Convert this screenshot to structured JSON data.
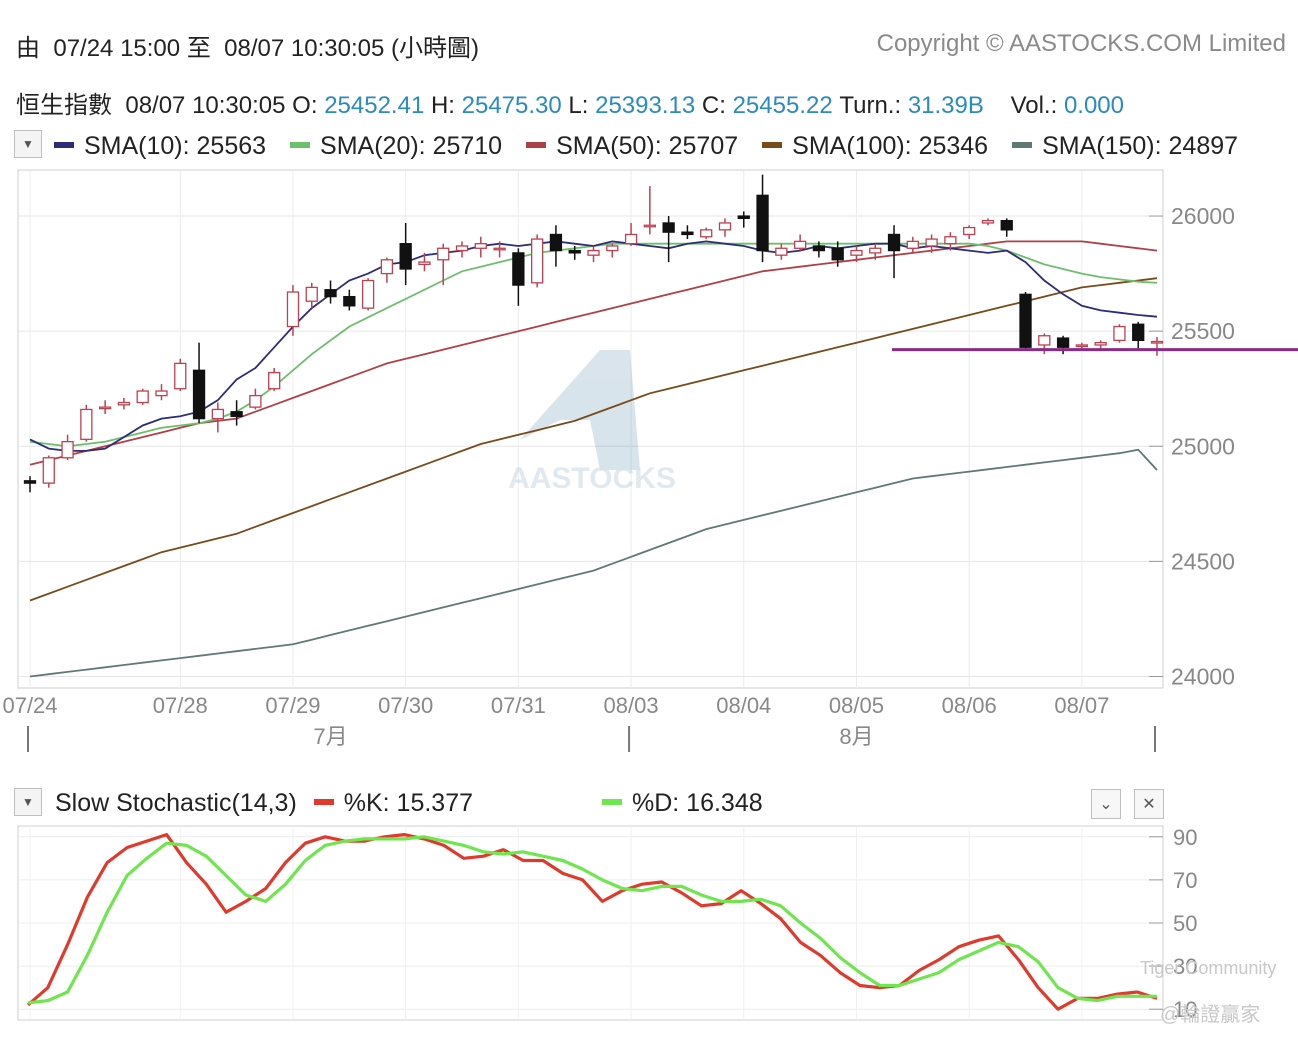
{
  "header": {
    "range_prefix": "由",
    "range_from": "07/24 15:00",
    "range_to_word": "至",
    "range_to": "08/07 10:30:05",
    "range_suffix": "(小時圖)",
    "copyright": "Copyright © AASTOCKS.COM Limited"
  },
  "quote": {
    "name": "恒生指數",
    "time": "08/07 10:30:05",
    "o_label": "O:",
    "o": "25452.41",
    "h_label": "H:",
    "h": "25475.30",
    "l_label": "L:",
    "l": "25393.13",
    "c_label": "C:",
    "c": "25455.22",
    "turn_label": "Turn.:",
    "turn": "31.39B",
    "vol_label": "Vol.:",
    "vol": "0.000"
  },
  "colors": {
    "up": "#c04050",
    "down": "#111111",
    "sma10": "#2c2c7a",
    "sma20": "#6cc06c",
    "sma50": "#b04048",
    "sma100": "#7a4a1a",
    "sma150": "#5f7a76",
    "k": "#e03a2c",
    "d": "#6ee64e",
    "hline": "#8a2b8a",
    "value_text": "#2a8bbd"
  },
  "icons": {
    "dropdown": "triangle-down-icon",
    "collapse": "chevron-down-icon",
    "close": "close-icon",
    "watermark": "aastocks-logo"
  },
  "watermark": {
    "text": "AASTOCKS",
    "community": "Tiger Community",
    "author": "@輪證贏家"
  },
  "chart_data": [
    {
      "type": "candlestick",
      "ylim": [
        23950,
        26200
      ],
      "yticks": [
        24000,
        24500,
        25000,
        25500,
        26000
      ],
      "grid": true,
      "legend": "top",
      "x_tick_labels": [
        "07/24",
        "07/28",
        "07/29",
        "07/30",
        "07/31",
        "08/03",
        "08/04",
        "08/05",
        "08/06",
        "08/07"
      ],
      "x_tick_index": [
        0,
        8,
        14,
        20,
        26,
        32,
        38,
        44,
        50,
        56
      ],
      "month_labels": [
        {
          "label": "7月",
          "index": 16
        },
        {
          "label": "8月",
          "index": 44
        }
      ],
      "sma_legend": [
        {
          "name": "SMA(10)",
          "value": "25563",
          "key": "sma10"
        },
        {
          "name": "SMA(20)",
          "value": "25710",
          "key": "sma20"
        },
        {
          "name": "SMA(50)",
          "value": "25707",
          "key": "sma50"
        },
        {
          "name": "SMA(100)",
          "value": "25346",
          "key": "sma100"
        },
        {
          "name": "SMA(150)",
          "value": "24897",
          "key": "sma150"
        }
      ],
      "horizontal_line": 25420,
      "candles": [
        [
          24850,
          24870,
          24800,
          24840
        ],
        [
          24840,
          24960,
          24820,
          24950
        ],
        [
          24950,
          25050,
          24940,
          25020
        ],
        [
          25030,
          25180,
          25020,
          25160
        ],
        [
          25170,
          25200,
          25140,
          25170
        ],
        [
          25180,
          25210,
          25160,
          25190
        ],
        [
          25190,
          25250,
          25180,
          25240
        ],
        [
          25220,
          25270,
          25200,
          25240
        ],
        [
          25250,
          25380,
          25240,
          25360
        ],
        [
          25330,
          25450,
          25100,
          25120
        ],
        [
          25120,
          25190,
          25060,
          25160
        ],
        [
          25150,
          25200,
          25090,
          25130
        ],
        [
          25170,
          25250,
          25160,
          25220
        ],
        [
          25250,
          25340,
          25240,
          25320
        ],
        [
          25520,
          25700,
          25480,
          25670
        ],
        [
          25630,
          25710,
          25600,
          25690
        ],
        [
          25680,
          25720,
          25620,
          25650
        ],
        [
          25650,
          25680,
          25590,
          25610
        ],
        [
          25600,
          25730,
          25590,
          25720
        ],
        [
          25750,
          25820,
          25710,
          25810
        ],
        [
          25880,
          25970,
          25700,
          25770
        ],
        [
          25790,
          25840,
          25760,
          25800
        ],
        [
          25810,
          25880,
          25700,
          25860
        ],
        [
          25850,
          25890,
          25820,
          25870
        ],
        [
          25860,
          25910,
          25820,
          25880
        ],
        [
          25860,
          25890,
          25820,
          25860
        ],
        [
          25840,
          25860,
          25610,
          25700
        ],
        [
          25710,
          25920,
          25690,
          25900
        ],
        [
          25920,
          25960,
          25780,
          25850
        ],
        [
          25850,
          25870,
          25810,
          25840
        ],
        [
          25830,
          25870,
          25800,
          25850
        ],
        [
          25850,
          25880,
          25820,
          25870
        ],
        [
          25880,
          25970,
          25870,
          25920
        ],
        [
          25960,
          26130,
          25920,
          25960
        ],
        [
          25970,
          26000,
          25800,
          25930
        ],
        [
          25930,
          25960,
          25900,
          25920
        ],
        [
          25910,
          25950,
          25900,
          25940
        ],
        [
          25940,
          25990,
          25910,
          25970
        ],
        [
          26000,
          26020,
          25950,
          25990
        ],
        [
          26090,
          26180,
          25800,
          25850
        ],
        [
          25830,
          25880,
          25810,
          25860
        ],
        [
          25860,
          25920,
          25850,
          25890
        ],
        [
          25870,
          25890,
          25820,
          25850
        ],
        [
          25860,
          25890,
          25780,
          25810
        ],
        [
          25830,
          25870,
          25800,
          25850
        ],
        [
          25840,
          25880,
          25810,
          25860
        ],
        [
          25920,
          25960,
          25730,
          25850
        ],
        [
          25860,
          25910,
          25840,
          25890
        ],
        [
          25870,
          25920,
          25840,
          25900
        ],
        [
          25880,
          25930,
          25850,
          25910
        ],
        [
          25920,
          25960,
          25900,
          25950
        ],
        [
          25970,
          25990,
          25960,
          25980
        ],
        [
          25980,
          25990,
          25910,
          25940
        ],
        [
          25660,
          25670,
          25420,
          25430
        ],
        [
          25440,
          25490,
          25400,
          25480
        ],
        [
          25470,
          25480,
          25400,
          25430
        ],
        [
          25440,
          25450,
          25420,
          25440
        ],
        [
          25440,
          25460,
          25420,
          25450
        ],
        [
          25460,
          25530,
          25450,
          25520
        ],
        [
          25530,
          25540,
          25420,
          25460
        ],
        [
          25450,
          25475,
          25393,
          25455
        ]
      ],
      "sma10": [
        25030,
        24990,
        24980,
        24980,
        24990,
        25040,
        25090,
        25120,
        25130,
        25150,
        25200,
        25290,
        25340,
        25430,
        25520,
        25600,
        25660,
        25720,
        25750,
        25790,
        25800,
        25830,
        25840,
        25850,
        25870,
        25880,
        25870,
        25880,
        25890,
        25880,
        25870,
        25890,
        25880,
        25870,
        25860,
        25880,
        25890,
        25880,
        25870,
        25850,
        25840,
        25850,
        25870,
        25860,
        25870,
        25880,
        25880,
        25860,
        25870,
        25860,
        25850,
        25840,
        25850,
        25800,
        25720,
        25660,
        25610,
        25590,
        25580,
        25570,
        25563
      ],
      "sma20": [
        25020,
        25010,
        25000,
        25010,
        25020,
        25040,
        25060,
        25080,
        25090,
        25100,
        25120,
        25150,
        25200,
        25260,
        25330,
        25400,
        25460,
        25520,
        25560,
        25600,
        25640,
        25680,
        25720,
        25760,
        25780,
        25800,
        25820,
        25840,
        25850,
        25860,
        25870,
        25880,
        25880,
        25880,
        25880,
        25880,
        25880,
        25880,
        25880,
        25880,
        25880,
        25880,
        25880,
        25880,
        25880,
        25880,
        25880,
        25880,
        25880,
        25880,
        25880,
        25870,
        25850,
        25820,
        25790,
        25770,
        25750,
        25735,
        25725,
        25715,
        25710
      ],
      "sma50": [
        24920,
        24940,
        24960,
        24980,
        25000,
        25020,
        25040,
        25060,
        25080,
        25100,
        25110,
        25120,
        25150,
        25180,
        25210,
        25240,
        25270,
        25300,
        25330,
        25360,
        25380,
        25400,
        25420,
        25440,
        25460,
        25480,
        25500,
        25520,
        25540,
        25560,
        25580,
        25600,
        25620,
        25640,
        25660,
        25680,
        25700,
        25720,
        25740,
        25760,
        25770,
        25780,
        25790,
        25800,
        25810,
        25820,
        25830,
        25840,
        25850,
        25860,
        25870,
        25880,
        25890,
        25890,
        25890,
        25890,
        25890,
        25880,
        25870,
        25860,
        25850
      ],
      "sma100": [
        24330,
        24360,
        24390,
        24420,
        24450,
        24480,
        24510,
        24540,
        24560,
        24580,
        24600,
        24620,
        24650,
        24680,
        24710,
        24740,
        24770,
        24800,
        24830,
        24860,
        24890,
        24920,
        24950,
        24980,
        25010,
        25030,
        25050,
        25070,
        25090,
        25110,
        25140,
        25170,
        25200,
        25230,
        25250,
        25270,
        25290,
        25310,
        25330,
        25350,
        25370,
        25390,
        25410,
        25430,
        25450,
        25470,
        25490,
        25510,
        25530,
        25550,
        25570,
        25590,
        25610,
        25630,
        25650,
        25670,
        25690,
        25700,
        25710,
        25720,
        25730
      ],
      "sma150": [
        24000,
        24010,
        24020,
        24030,
        24040,
        24050,
        24060,
        24070,
        24080,
        24090,
        24100,
        24110,
        24120,
        24130,
        24140,
        24160,
        24180,
        24200,
        24220,
        24240,
        24260,
        24280,
        24300,
        24320,
        24340,
        24360,
        24380,
        24400,
        24420,
        24440,
        24460,
        24490,
        24520,
        24550,
        24580,
        24610,
        24640,
        24660,
        24680,
        24700,
        24720,
        24740,
        24760,
        24780,
        24800,
        24820,
        24840,
        24860,
        24870,
        24880,
        24890,
        24900,
        24910,
        24920,
        24930,
        24940,
        24950,
        24960,
        24970,
        24985,
        24897
      ]
    },
    {
      "type": "line",
      "title": "Slow Stochastic(14,3)",
      "ylim": [
        5,
        95
      ],
      "yticks": [
        10,
        30,
        50,
        70,
        90
      ],
      "grid": true,
      "legend": "top",
      "series": [
        {
          "name": "%K",
          "value": "15.377",
          "key": "k",
          "values": [
            12,
            20,
            40,
            62,
            78,
            85,
            88,
            91,
            78,
            68,
            55,
            60,
            66,
            78,
            87,
            90,
            88,
            88,
            90,
            91,
            89,
            86,
            80,
            81,
            84,
            79,
            79,
            73,
            70,
            60,
            65,
            68,
            69,
            64,
            58,
            59,
            65,
            59,
            52,
            41,
            35,
            27,
            21,
            20,
            21,
            28,
            33,
            39,
            42,
            44,
            33,
            20,
            10,
            15,
            15,
            17,
            18,
            15
          ]
        },
        {
          "name": "%D",
          "value": "16.348",
          "key": "d",
          "values": [
            13,
            14,
            18,
            35,
            55,
            72,
            80,
            87,
            86,
            81,
            72,
            63,
            60,
            68,
            79,
            86,
            88,
            89,
            89,
            89,
            90,
            88,
            86,
            83,
            82,
            83,
            81,
            79,
            75,
            70,
            66,
            65,
            67,
            67,
            63,
            60,
            60,
            61,
            58,
            50,
            43,
            34,
            27,
            21,
            21,
            24,
            27,
            33,
            37,
            41,
            39,
            32,
            20,
            15,
            14,
            16,
            16,
            16
          ]
        }
      ]
    }
  ]
}
